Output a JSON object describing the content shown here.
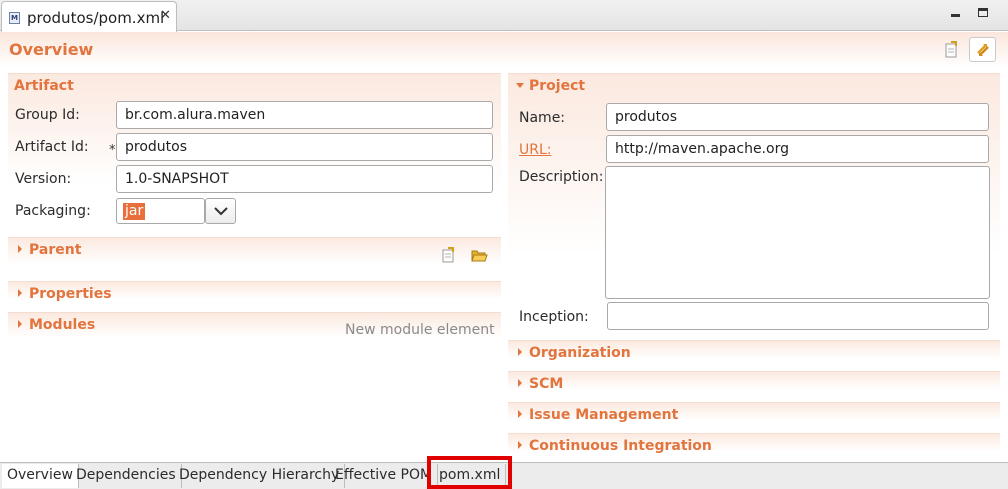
{
  "editor_tab": {
    "title": "produtos/pom.xml",
    "icon": "maven-file-icon",
    "icon_glyph": "M",
    "close_glyph": "✕"
  },
  "header": {
    "title": "Overview",
    "icons": [
      "open-parent-pom-icon",
      "synchronize-icon"
    ]
  },
  "artifact": {
    "title": "Artifact",
    "group_id_label": "Group Id:",
    "group_id_value": "br.com.alura.maven",
    "artifact_id_label": "Artifact Id:",
    "artifact_id_required": "*",
    "artifact_id_value": "produtos",
    "version_label": "Version:",
    "version_value": "1.0-SNAPSHOT",
    "packaging_label": "Packaging:",
    "packaging_value": "jar"
  },
  "parent": {
    "title": "Parent",
    "icons": [
      "open-parent-icon",
      "select-parent-folder-icon"
    ]
  },
  "properties": {
    "title": "Properties"
  },
  "modules": {
    "title": "Modules",
    "hint": "New module element"
  },
  "project": {
    "title": "Project",
    "name_label": "Name:",
    "name_value": "produtos",
    "url_label": "URL:",
    "url_value": "http://maven.apache.org",
    "description_label": "Description:",
    "description_value": "",
    "inception_label": "Inception:",
    "inception_value": ""
  },
  "right_sections": {
    "organization": "Organization",
    "scm": "SCM",
    "issue_management": "Issue Management",
    "continuous_integration": "Continuous Integration"
  },
  "page_tabs": {
    "active": "Overview",
    "items": [
      "Overview",
      "Dependencies",
      "Dependency Hierarchy",
      "Effective POM",
      "pom.xml"
    ]
  },
  "colors": {
    "section_title": "#e2743e",
    "highlight_box": "#e00000",
    "selection": "#e86f3c"
  }
}
